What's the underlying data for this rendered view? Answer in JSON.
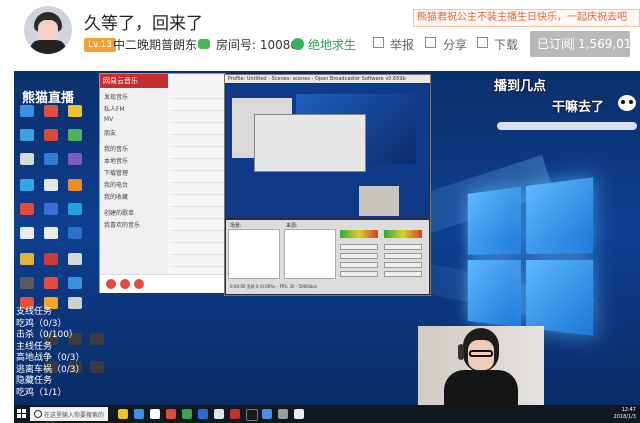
{
  "header": {
    "title": "久等了，回来了",
    "notice": "熊猫君祝公主不装主播生日快乐，一起庆祝去吧",
    "level": "Lv.13",
    "host": "中二晚期普朗东",
    "room": "房间号: 10086",
    "game": "绝地求生",
    "actions": {
      "report": "举报",
      "share": "分享",
      "download": "下载"
    },
    "subscribe_label": "已订阅",
    "subscribe_count": "1,569,012"
  },
  "stream": {
    "brand": "熊猫直播",
    "caption_top": "播到几点",
    "caption_mid": "干嘛去了",
    "subtitle": "丢包",
    "tasks": [
      "支线任务",
      "吃鸡（0/3）",
      "击杀（0/100）",
      "主线任务",
      "高地战争（0/3）",
      "逃离车祸（0/3）",
      "隐藏任务",
      "吃鸡（1/1）"
    ],
    "music_app": {
      "title": "网易云音乐",
      "menu": [
        "发现音乐",
        "私人FM",
        "MV",
        "朋友",
        "我的音乐",
        "本地音乐",
        "下载管理",
        "我的电台",
        "我的收藏",
        "创建的歌单",
        "我喜欢的音乐"
      ]
    },
    "obs": {
      "title": "Profile: Untitled - Scenes: scenes - Open Broadcaster Software v0.659b",
      "scenes_label": "场景:",
      "sources_label": "来源:",
      "status": "0:00:00 丢帧 0 (0.00%) - FPS: 30 - 5000kb/s"
    },
    "taskbar": {
      "search_placeholder": "在这里输入你要搜索的内容",
      "time": "12:47",
      "date": "2018/1/3"
    }
  },
  "colors": {
    "accent": "#c62f2f",
    "subscribe_bg": "#b9b9b9",
    "level_bg": "#f0a239",
    "game_green": "#2fb55a"
  }
}
